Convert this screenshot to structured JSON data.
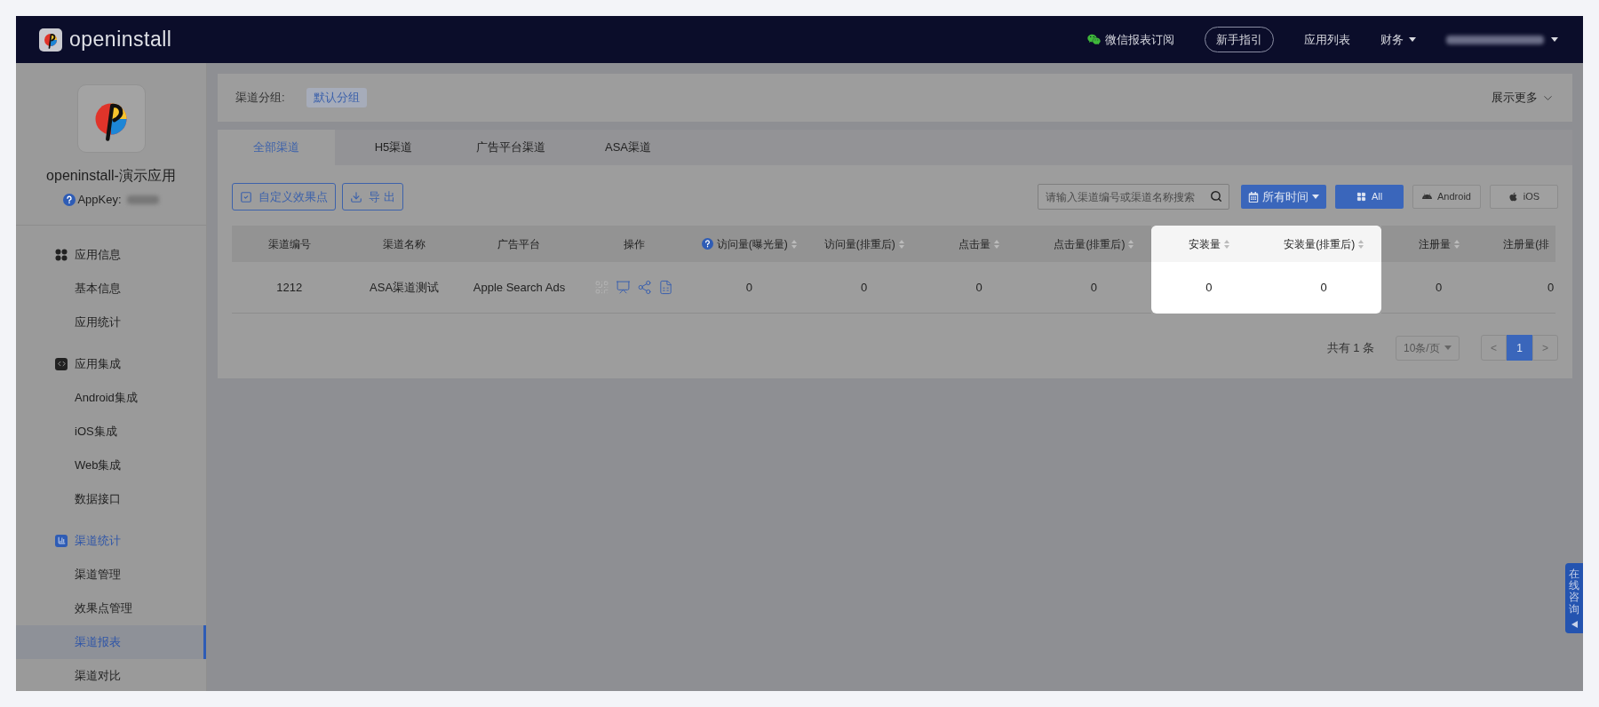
{
  "header": {
    "brand": "openinstall",
    "nav": [
      {
        "kind": "wechat",
        "label": "微信报表订阅"
      },
      {
        "kind": "pill",
        "label": "新手指引"
      },
      {
        "kind": "link",
        "label": "应用列表"
      },
      {
        "kind": "dropdown",
        "label": "财务"
      },
      {
        "kind": "account"
      }
    ]
  },
  "app": {
    "name": "openinstall-演示应用",
    "appkey_label": "AppKey:"
  },
  "sidebar": [
    {
      "kind": "apps",
      "label": "应用信息",
      "selected": false,
      "children": [
        {
          "label": "基本信息",
          "selected": false
        },
        {
          "label": "应用统计",
          "selected": false
        }
      ]
    },
    {
      "kind": "code",
      "label": "应用集成",
      "selected": false,
      "children": [
        {
          "label": "Android集成",
          "selected": false
        },
        {
          "label": "iOS集成",
          "selected": false
        },
        {
          "label": "Web集成",
          "selected": false
        },
        {
          "label": "数据接口",
          "selected": false
        }
      ]
    },
    {
      "kind": "chart",
      "label": "渠道统计",
      "selected": true,
      "children": [
        {
          "label": "渠道管理",
          "selected": false
        },
        {
          "label": "效果点管理",
          "selected": false
        },
        {
          "label": "渠道报表",
          "selected": true
        },
        {
          "label": "渠道对比",
          "selected": false
        }
      ]
    }
  ],
  "group_filter": {
    "label": "渠道分组:",
    "chip": "默认分组",
    "more": "展示更多"
  },
  "tabs": [
    {
      "label": "全部渠道",
      "selected": true
    },
    {
      "label": "H5渠道",
      "selected": false
    },
    {
      "label": "广告平台渠道",
      "selected": false
    },
    {
      "label": "ASA渠道",
      "selected": false
    }
  ],
  "toolbar": {
    "buttons": [
      {
        "kind": "checkbox",
        "label": "自定义效果点"
      },
      {
        "kind": "export",
        "label": "导 出"
      }
    ],
    "search": {
      "placeholder": "请输入渠道编号或渠道名称搜索"
    },
    "time": "所有时间",
    "platforms": [
      {
        "kind": "all",
        "label": "All",
        "selected": true
      },
      {
        "kind": "android",
        "label": "Android",
        "selected": false
      },
      {
        "kind": "ios",
        "label": "iOS",
        "selected": false
      }
    ]
  },
  "table": {
    "columns": [
      {
        "label": "渠道编号",
        "kind": "text",
        "sortable": false,
        "help": false,
        "highlighted": false
      },
      {
        "label": "渠道名称",
        "kind": "text",
        "sortable": false,
        "help": false,
        "highlighted": false
      },
      {
        "label": "广告平台",
        "kind": "text",
        "sortable": false,
        "help": false,
        "highlighted": false
      },
      {
        "label": "操作",
        "kind": "actions",
        "sortable": false,
        "help": false,
        "highlighted": false
      },
      {
        "label": "访问量(曝光量)",
        "kind": "text",
        "sortable": true,
        "help": true,
        "highlighted": false
      },
      {
        "label": "访问量(排重后)",
        "kind": "text",
        "sortable": true,
        "help": false,
        "highlighted": false
      },
      {
        "label": "点击量",
        "kind": "text",
        "sortable": true,
        "help": false,
        "highlighted": false
      },
      {
        "label": "点击量(排重后)",
        "kind": "text",
        "sortable": true,
        "help": false,
        "highlighted": false
      },
      {
        "label": "安装量",
        "kind": "text",
        "sortable": true,
        "help": false,
        "highlighted": true
      },
      {
        "label": "安装量(排重后)",
        "kind": "text",
        "sortable": true,
        "help": false,
        "highlighted": true
      },
      {
        "label": "注册量",
        "kind": "text",
        "sortable": true,
        "help": false,
        "highlighted": false
      },
      {
        "label": "注册量(排",
        "kind": "text",
        "sortable": false,
        "help": false,
        "highlighted": false
      }
    ],
    "rows": [
      {
        "cells": [
          "1212",
          "ASA渠道测试",
          "Apple Search Ads",
          "",
          "0",
          "0",
          "0",
          "0",
          "0",
          "0",
          "0",
          "0"
        ],
        "actions": [
          {
            "kind": "qrcode",
            "disabled": true
          },
          {
            "kind": "monitor",
            "disabled": false
          },
          {
            "kind": "share",
            "disabled": false
          },
          {
            "kind": "excel",
            "disabled": false
          }
        ]
      }
    ]
  },
  "pagination": {
    "total": "共有 1 条",
    "page_size": "10条/页",
    "prev": "<",
    "pages": [
      {
        "label": "1",
        "selected": true
      }
    ],
    "next": ">"
  },
  "side_tab": {
    "label": "在线咨询"
  }
}
